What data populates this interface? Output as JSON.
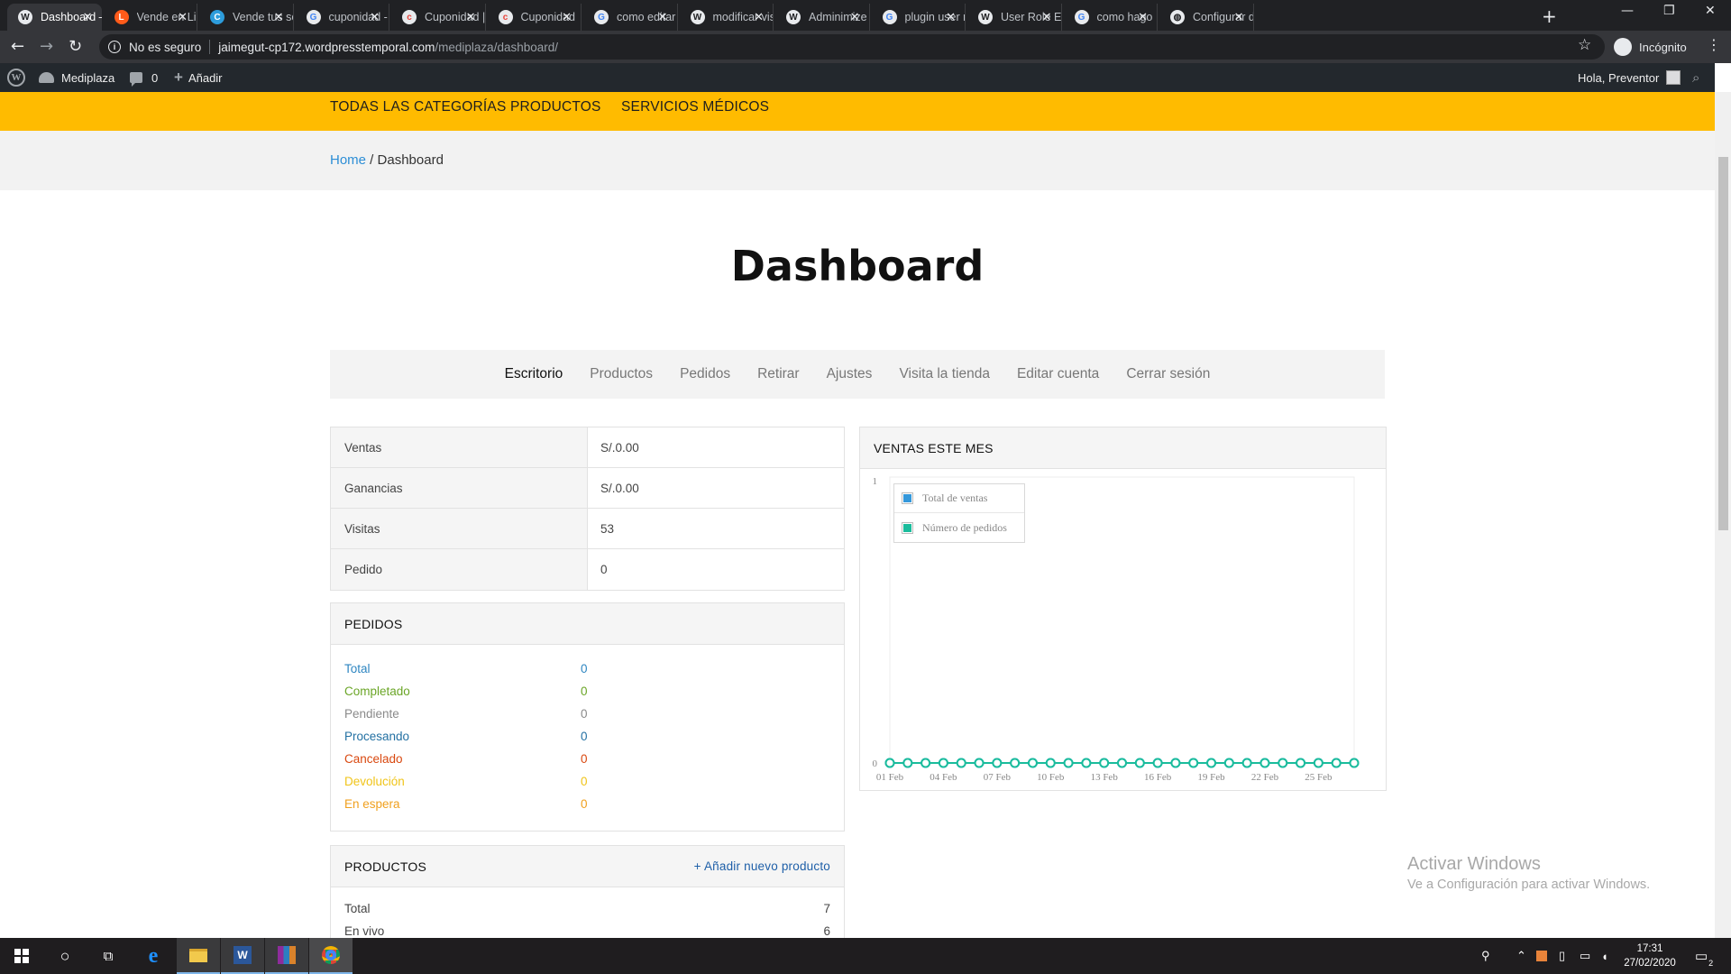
{
  "browser": {
    "tabs": [
      {
        "label": "Dashboard –",
        "icon": "wordpress-globe-icon",
        "active": true
      },
      {
        "label": "Vende en Lin",
        "icon": "linio-icon"
      },
      {
        "label": "Vende tus se",
        "icon": "cuponidad-c-icon"
      },
      {
        "label": "cuponidad -",
        "icon": "google-icon"
      },
      {
        "label": "Cuponidad |",
        "icon": "cuponidad-icon"
      },
      {
        "label": "Cuponidad",
        "icon": "cuponidad-icon"
      },
      {
        "label": "como editar",
        "icon": "google-icon"
      },
      {
        "label": "modificar vis",
        "icon": "wordpress-icon"
      },
      {
        "label": "Adminimize",
        "icon": "wordpress-icon"
      },
      {
        "label": "plugin user r",
        "icon": "google-icon"
      },
      {
        "label": "User Role Ed",
        "icon": "wordpress-icon"
      },
      {
        "label": "como hago",
        "icon": "google-icon"
      },
      {
        "label": "Configurar d",
        "icon": "globe-icon"
      }
    ],
    "tab_close": "✕",
    "new_tab": "+",
    "window_controls": {
      "minimize": "—",
      "restore": "❐",
      "close": "✕"
    },
    "address": {
      "security_label": "No es seguro",
      "host": "jaimegut-cp172.wordpresstemporal.com",
      "path": "/mediplaza/dashboard/"
    },
    "profile_label": "Incógnito"
  },
  "adminbar": {
    "site_name": "Mediplaza",
    "comments_count": "0",
    "add_label": "Añadir",
    "greeting": "Hola, Preventor"
  },
  "sitenav": {
    "items": [
      "TODAS LAS CATEGORÍAS",
      "PRODUCTOS",
      "SERVICIOS MÉDICOS"
    ]
  },
  "breadcrumb": {
    "home": "Home",
    "separator": " / ",
    "current": "Dashboard"
  },
  "page": {
    "title": "Dashboard"
  },
  "dashboard_menu": {
    "items": [
      "Escritorio",
      "Productos",
      "Pedidos",
      "Retirar",
      "Ajustes",
      "Visita la tienda",
      "Editar cuenta",
      "Cerrar sesión"
    ],
    "active_index": 0
  },
  "stats": [
    {
      "label": "Ventas",
      "value": "S/.0.00"
    },
    {
      "label": "Ganancias",
      "value": "S/.0.00"
    },
    {
      "label": "Visitas",
      "value": "53"
    },
    {
      "label": "Pedido",
      "value": "0"
    }
  ],
  "orders": {
    "title": "PEDIDOS",
    "rows": [
      {
        "label": "Total",
        "value": "0",
        "color": "#2e86c1"
      },
      {
        "label": "Completado",
        "value": "0",
        "color": "#6aa526"
      },
      {
        "label": "Pendiente",
        "value": "0",
        "color": "#8a8a8a"
      },
      {
        "label": "Procesando",
        "value": "0",
        "color": "#2471a3"
      },
      {
        "label": "Cancelado",
        "value": "0",
        "color": "#d9480f"
      },
      {
        "label": "Devolución",
        "value": "0",
        "color": "#f0c419"
      },
      {
        "label": "En espera",
        "value": "0",
        "color": "#f0a01e"
      }
    ]
  },
  "products": {
    "title": "PRODUCTOS",
    "add_link": "+ Añadir nuevo producto",
    "rows": [
      {
        "label": "Total",
        "value": "7"
      },
      {
        "label": "En vivo",
        "value": "6"
      }
    ]
  },
  "sales_panel": {
    "title": "VENTAS ESTE MES"
  },
  "chart_data": {
    "type": "line",
    "title": "VENTAS ESTE MES",
    "x": [
      "01 Feb",
      "02 Feb",
      "03 Feb",
      "04 Feb",
      "05 Feb",
      "06 Feb",
      "07 Feb",
      "08 Feb",
      "09 Feb",
      "10 Feb",
      "11 Feb",
      "12 Feb",
      "13 Feb",
      "14 Feb",
      "15 Feb",
      "16 Feb",
      "17 Feb",
      "18 Feb",
      "19 Feb",
      "20 Feb",
      "21 Feb",
      "22 Feb",
      "23 Feb",
      "24 Feb",
      "25 Feb",
      "26 Feb",
      "27 Feb"
    ],
    "tick_labels": [
      "01 Feb",
      "04 Feb",
      "07 Feb",
      "10 Feb",
      "13 Feb",
      "16 Feb",
      "19 Feb",
      "22 Feb",
      "25 Feb"
    ],
    "series": [
      {
        "name": "Total de ventas",
        "color": "#3498db",
        "values": [
          0,
          0,
          0,
          0,
          0,
          0,
          0,
          0,
          0,
          0,
          0,
          0,
          0,
          0,
          0,
          0,
          0,
          0,
          0,
          0,
          0,
          0,
          0,
          0,
          0,
          0,
          0
        ]
      },
      {
        "name": "Número de pedidos",
        "color": "#1abc9c",
        "values": [
          0,
          0,
          0,
          0,
          0,
          0,
          0,
          0,
          0,
          0,
          0,
          0,
          0,
          0,
          0,
          0,
          0,
          0,
          0,
          0,
          0,
          0,
          0,
          0,
          0,
          0,
          0
        ]
      }
    ],
    "ylim": [
      0,
      1
    ],
    "y_ticks": [
      "0",
      "1"
    ],
    "grid": false,
    "legend": "top-left"
  },
  "windows": {
    "activate_title": "Activar Windows",
    "activate_sub": "Ve a Configuración para activar Windows.",
    "clock_time": "17:31",
    "clock_date": "27/02/2020",
    "notifications_count": "2"
  }
}
